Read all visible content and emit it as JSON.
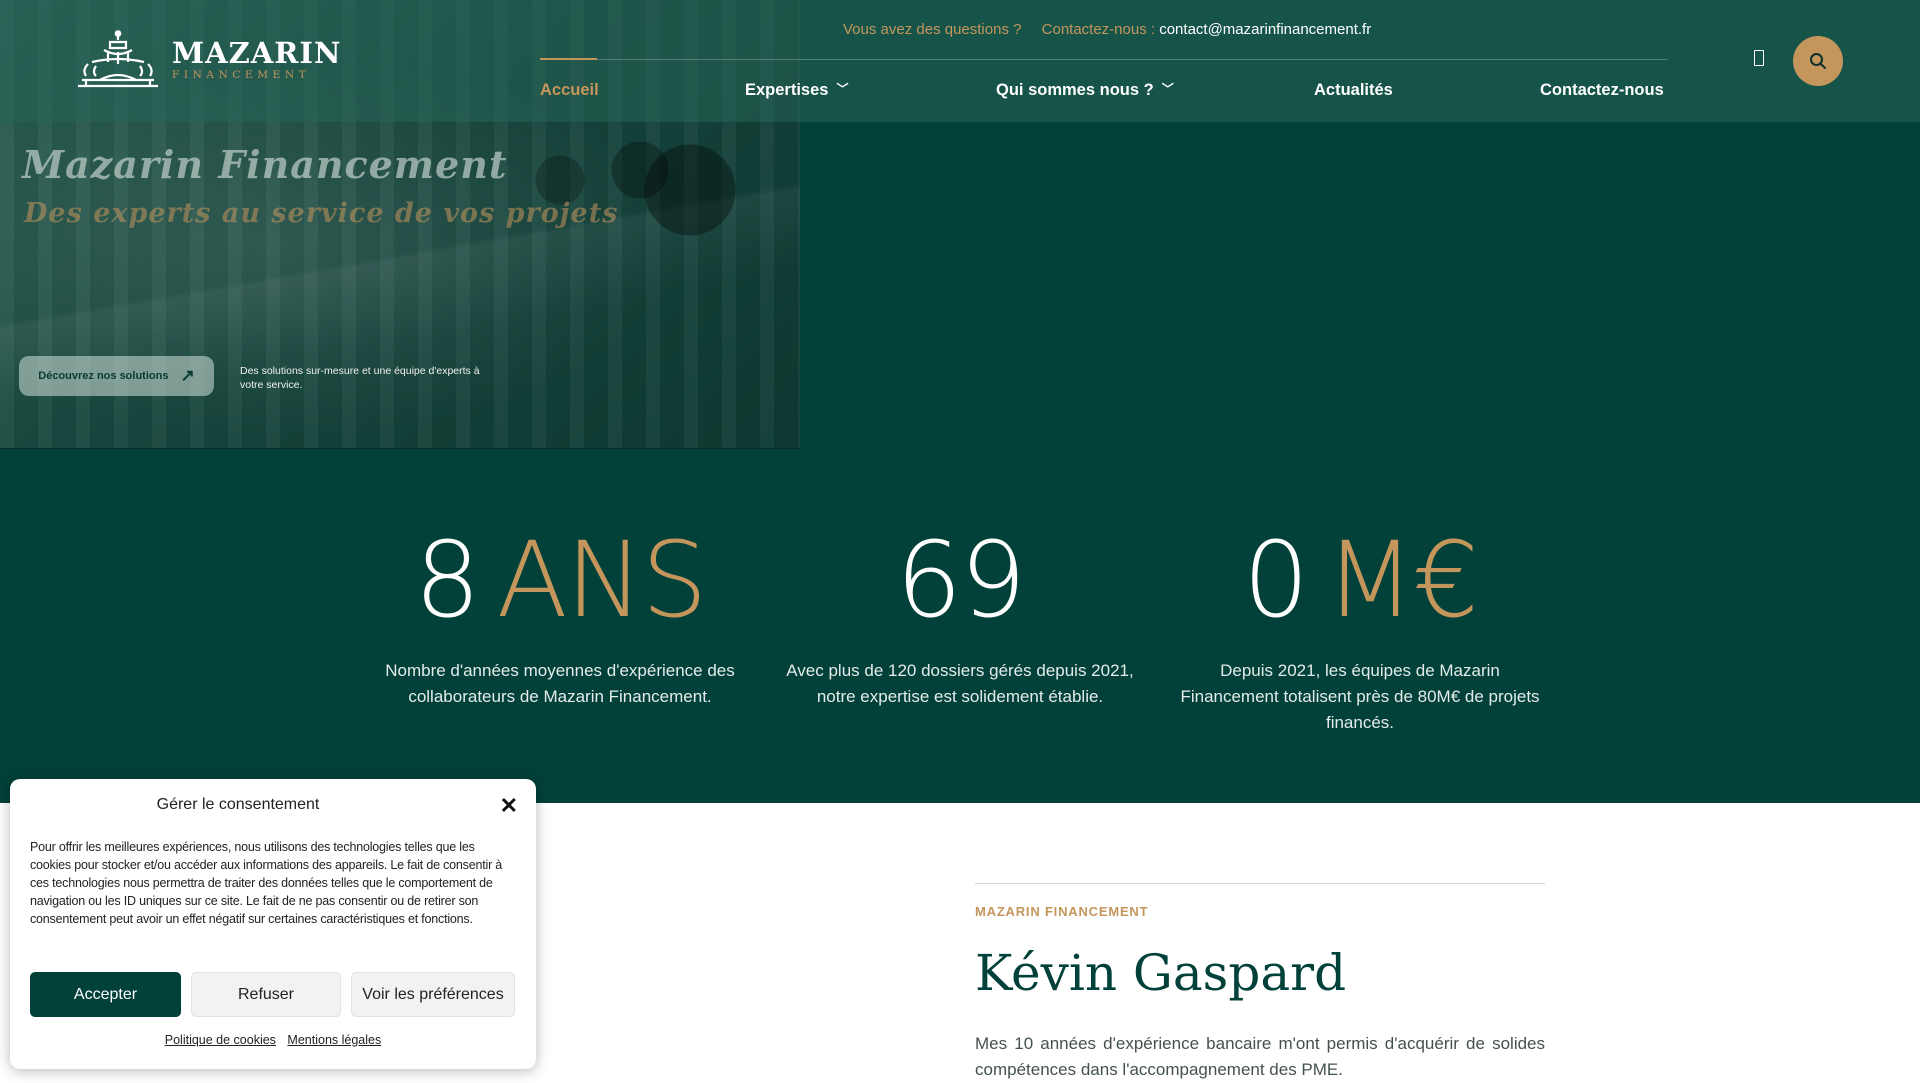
{
  "header": {
    "logo": {
      "name": "MAZARIN",
      "sub": "FINANCEMENT"
    },
    "topline": {
      "question": "Vous avez des questions ?",
      "contact_label": "Contactez-nous :",
      "email": "contact@mazarinfinancement.fr"
    },
    "nav": [
      {
        "label": "Accueil",
        "active": true
      },
      {
        "label": "Expertises",
        "has_dropdown": true
      },
      {
        "label": "Qui sommes nous ?",
        "has_dropdown": true
      },
      {
        "label": "Actualités"
      },
      {
        "label": "Contactez-nous"
      }
    ],
    "icons": {
      "menu": "menu-icon",
      "search": "search-icon"
    }
  },
  "hero": {
    "title": "Mazarin Financement",
    "subtitle": "Des experts au service de vos projets",
    "cta_label": "Découvrez nos solutions",
    "tagline": "Des solutions sur-mesure et une équipe d'experts à votre service."
  },
  "stats": [
    {
      "number": "8",
      "unit": "ANS",
      "description": "Nombre d'années moyennes d'expérience des collaborateurs de Mazarin Financement."
    },
    {
      "number": "69",
      "unit": "",
      "description": "Avec plus de 120 dossiers gérés depuis 2021, notre expertise est solidement établie."
    },
    {
      "number": "0",
      "unit": "M€",
      "description": "Depuis 2021, les équipes de Mazarin Financement totalisent près de 80M€ de projets financés."
    }
  ],
  "about": {
    "label": "MAZARIN FINANCEMENT",
    "name": "Kévin Gaspard",
    "text": "Mes 10 années d'expérience bancaire m'ont permis d'acquérir de solides compétences dans l'accompagnement des PME."
  },
  "cookie": {
    "title": "Gérer le consentement",
    "text": "Pour offrir les meilleures expériences, nous utilisons des technologies telles que les cookies pour stocker et/ou accéder aux informations des appareils. Le fait de consentir à ces technologies nous permettra de traiter des données telles que le comportement de navigation ou les ID uniques sur ce site. Le fait de ne pas consentir ou de retirer son consentement peut avoir un effet négatif sur certaines caractéristiques et fonctions.",
    "accept": "Accepter",
    "refuse": "Refuser",
    "preferences": "Voir les préférences",
    "links": [
      "Politique de cookies",
      "Mentions légales"
    ]
  },
  "colors": {
    "brand_green": "#024139",
    "accent_gold": "#c4965c"
  }
}
